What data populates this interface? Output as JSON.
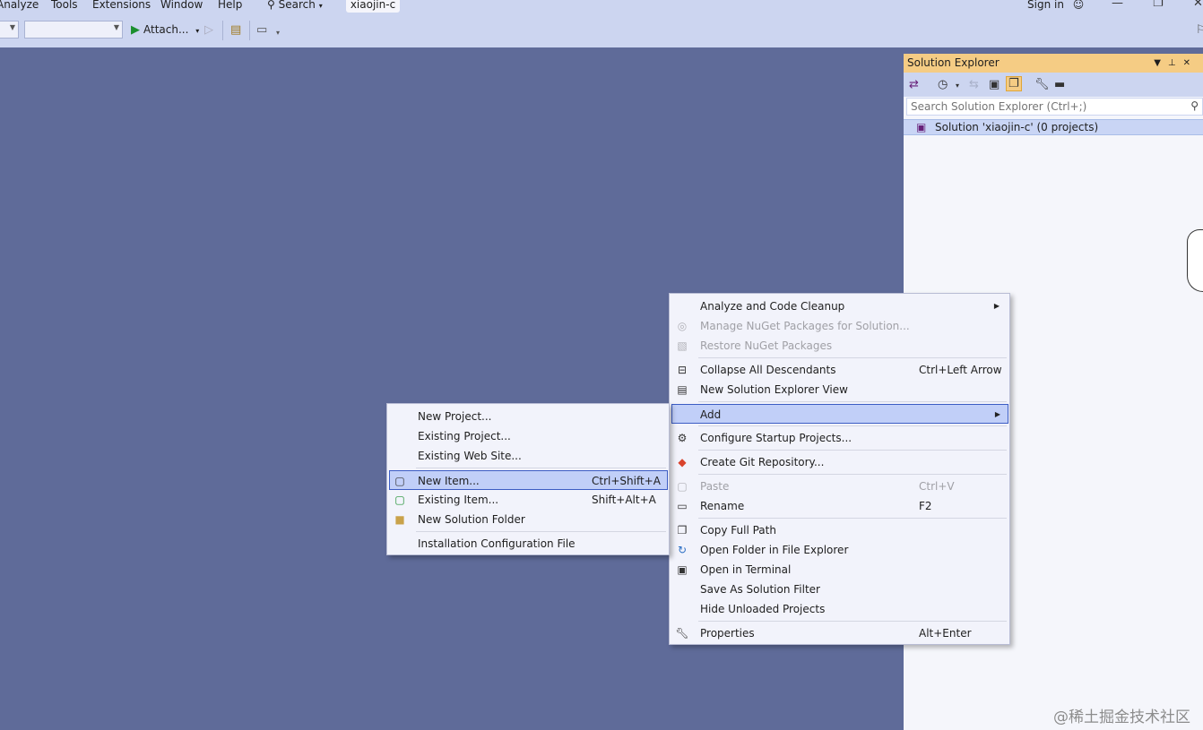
{
  "menubar": {
    "items": [
      "Analyze",
      "Tools",
      "Extensions",
      "Window",
      "Help"
    ],
    "search": "Search",
    "project_tab": "xiaojin-c",
    "sign_in": "Sign in"
  },
  "toolbar": {
    "attach_label": "Attach..."
  },
  "solution_explorer": {
    "title": "Solution Explorer",
    "search_placeholder": "Search Solution Explorer (Ctrl+;)",
    "root": "Solution 'xiaojin-c' (0 projects)"
  },
  "context_menu": {
    "items": [
      {
        "label": "Analyze and Code Cleanup",
        "shortcut": ""
      },
      {
        "label": "Manage NuGet Packages for Solution...",
        "shortcut": ""
      },
      {
        "label": "Restore NuGet Packages",
        "shortcut": ""
      },
      {
        "label": "Collapse All Descendants",
        "shortcut": "Ctrl+Left Arrow"
      },
      {
        "label": "New Solution Explorer View",
        "shortcut": ""
      },
      {
        "label": "Add",
        "shortcut": ""
      },
      {
        "label": "Configure Startup Projects...",
        "shortcut": ""
      },
      {
        "label": "Create Git Repository...",
        "shortcut": ""
      },
      {
        "label": "Paste",
        "shortcut": "Ctrl+V"
      },
      {
        "label": "Rename",
        "shortcut": "F2"
      },
      {
        "label": "Copy Full Path",
        "shortcut": ""
      },
      {
        "label": "Open Folder in File Explorer",
        "shortcut": ""
      },
      {
        "label": "Open in Terminal",
        "shortcut": ""
      },
      {
        "label": "Save As Solution Filter",
        "shortcut": ""
      },
      {
        "label": "Hide Unloaded Projects",
        "shortcut": ""
      },
      {
        "label": "Properties",
        "shortcut": "Alt+Enter"
      }
    ]
  },
  "add_submenu": {
    "items": [
      {
        "label": "New Project...",
        "shortcut": ""
      },
      {
        "label": "Existing Project...",
        "shortcut": ""
      },
      {
        "label": "Existing Web Site...",
        "shortcut": ""
      },
      {
        "label": "New Item...",
        "shortcut": "Ctrl+Shift+A"
      },
      {
        "label": "Existing Item...",
        "shortcut": "Shift+Alt+A"
      },
      {
        "label": "New Solution Folder",
        "shortcut": ""
      },
      {
        "label": "Installation Configuration File",
        "shortcut": ""
      }
    ]
  },
  "watermark": "@稀土掘金技术社区",
  "colors": {
    "canvas": "#5f6b99",
    "chrome": "#ccd5f0",
    "panel_title": "#f5cc84",
    "menu_bg": "#f2f3fb",
    "highlight": "#c1cff8"
  }
}
